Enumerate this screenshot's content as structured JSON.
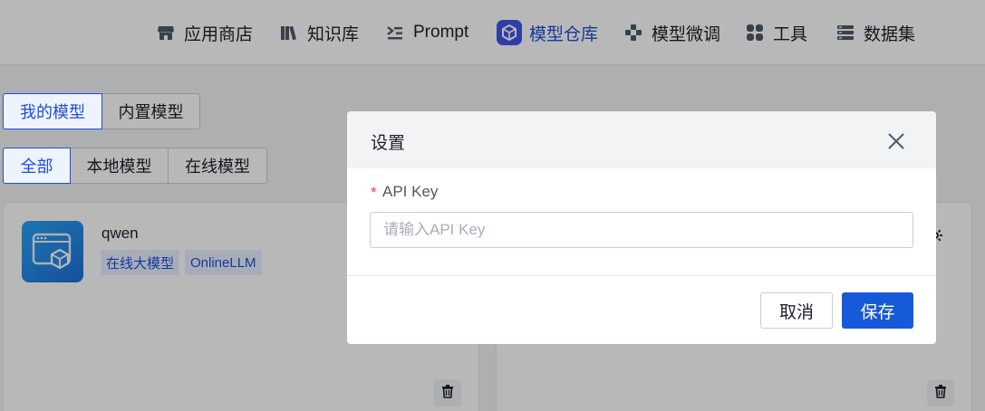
{
  "nav": {
    "items": [
      {
        "label": "应用商店",
        "icon": "store-icon"
      },
      {
        "label": "知识库",
        "icon": "books-icon"
      },
      {
        "label": "Prompt",
        "icon": "prompt-icon"
      },
      {
        "label": "模型仓库",
        "icon": "model-cube-icon",
        "active": true
      },
      {
        "label": "模型微调",
        "icon": "finetune-icon"
      },
      {
        "label": "工具",
        "icon": "tools-grid-icon"
      },
      {
        "label": "数据集",
        "icon": "dataset-icon"
      }
    ]
  },
  "owner_tabs": [
    {
      "label": "我的模型",
      "active": true
    },
    {
      "label": "内置模型",
      "active": false
    }
  ],
  "filter_tabs": [
    {
      "label": "全部",
      "active": true
    },
    {
      "label": "本地模型",
      "active": false
    },
    {
      "label": "在线模型",
      "active": false
    }
  ],
  "model_card": {
    "name": "qwen",
    "tags": [
      "在线大模型",
      "OnlineLLM"
    ]
  },
  "dialog": {
    "title": "设置",
    "field_label": "API Key",
    "required_mark": "*",
    "input_value": "",
    "input_placeholder": "请输入API Key",
    "cancel_label": "取消",
    "save_label": "保存"
  },
  "colors": {
    "accent": "#1659d9",
    "active_nav": "#4257e6",
    "required": "#f53f3f",
    "tag_bg": "#e8f0ff"
  }
}
